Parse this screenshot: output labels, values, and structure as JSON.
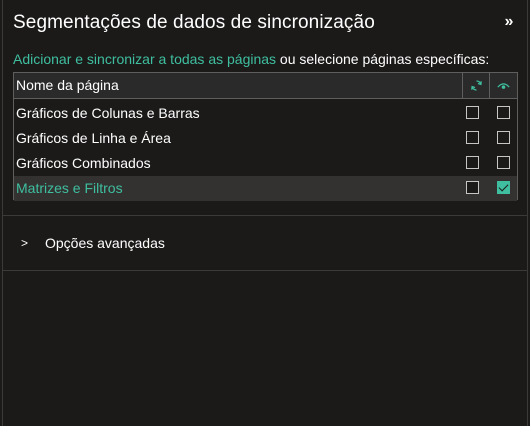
{
  "header": {
    "title": "Segmentações de dados de sincronização",
    "collapse_icon": "chevron-double-right-icon"
  },
  "description": {
    "link_text": "Adicionar e sincronizar a todas as páginas",
    "rest_text": " ou selecione páginas específicas:"
  },
  "table": {
    "column_name": "Nome da página",
    "sync_column_icon": "sync-icon",
    "visible_column_icon": "eye-icon",
    "rows": [
      {
        "label": "Gráficos de Colunas e Barras",
        "sync": false,
        "visible": false,
        "selected": false
      },
      {
        "label": "Gráficos de Linha e Área",
        "sync": false,
        "visible": false,
        "selected": false
      },
      {
        "label": "Gráficos Combinados",
        "sync": false,
        "visible": false,
        "selected": false
      },
      {
        "label": "Matrizes e Filtros",
        "sync": false,
        "visible": true,
        "selected": true
      }
    ]
  },
  "advanced": {
    "label": "Opções avançadas",
    "expanded": false
  },
  "colors": {
    "accent": "#3fbf9f",
    "background": "#1b1a19"
  }
}
